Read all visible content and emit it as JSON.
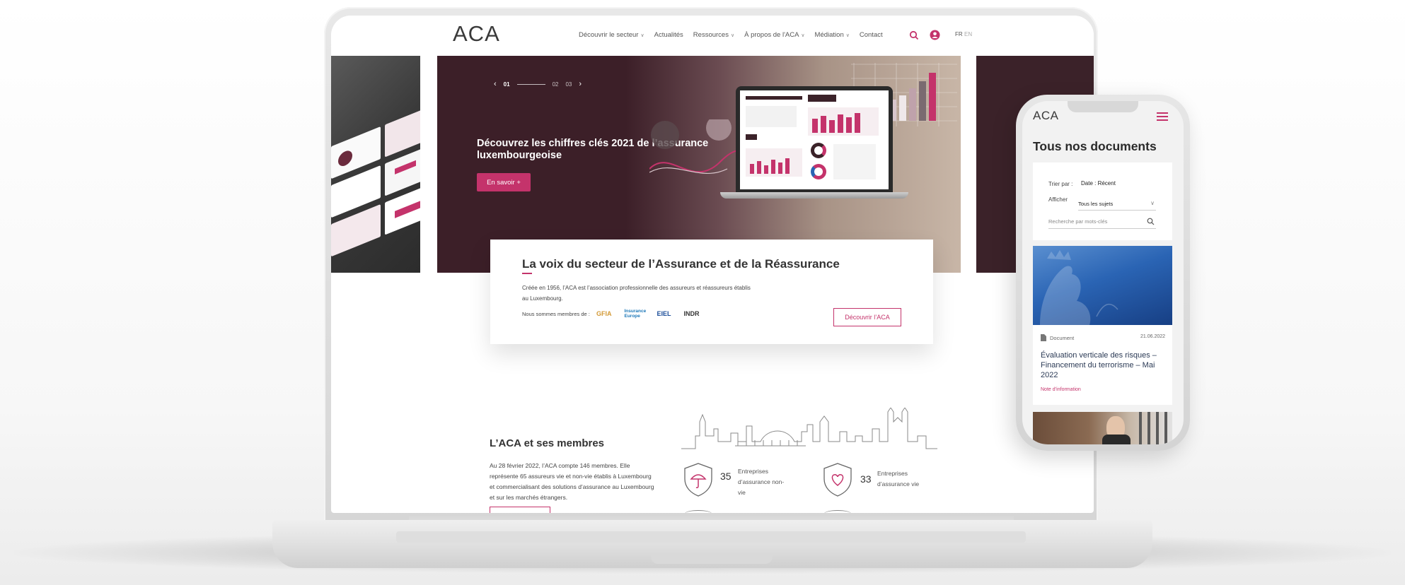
{
  "brand": {
    "logo": "ACA",
    "accent": "#c4336b",
    "dark": "#3c1f28"
  },
  "nav": {
    "items": [
      {
        "label": "Découvrir le secteur",
        "dropdown": true
      },
      {
        "label": "Actualités",
        "dropdown": false
      },
      {
        "label": "Ressources",
        "dropdown": true
      },
      {
        "label": "À propos de l'ACA",
        "dropdown": true
      },
      {
        "label": "Médiation",
        "dropdown": true
      },
      {
        "label": "Contact",
        "dropdown": false
      }
    ],
    "lang_fr": "FR",
    "lang_en": "EN",
    "icons": [
      "search-icon",
      "user-icon"
    ]
  },
  "hero": {
    "title": "Découvrez les chiffres clés 2021 de l’assurance luxembourgeoise",
    "button": "En savoir +",
    "pager": {
      "current": "01",
      "p2": "02",
      "p3": "03"
    }
  },
  "intro": {
    "title": "La voix du secteur de l’Assurance et de la Réassurance",
    "text": "Créée en 1956, l’ACA est l’association professionnelle des assureurs et réassureurs établis au Luxembourg.",
    "members_label": "Nous sommes membres de :",
    "partners": [
      "GFIA",
      "Insurance Europe",
      "EIEL",
      "INDR"
    ],
    "button": "Découvrir l’ACA"
  },
  "members": {
    "title": "L’ACA et ses membres",
    "text": "Au 28 février 2022, l’ACA compte 146 membres. Elle représente 65 assureurs vie et non-vie établis à Luxembourg et commercialisant des solutions d’assurance au Luxembourg et sur les marchés étrangers.",
    "stats": [
      {
        "value": "35",
        "label": "Entreprises d’assurance non-vie",
        "icon": "umbrella-icon"
      },
      {
        "value": "33",
        "label": "Entreprises d’assurance vie",
        "icon": "heart-icon"
      }
    ]
  },
  "mobile": {
    "logo": "ACA",
    "title": "Tous nos documents",
    "sort_label": "Trier par :",
    "sort_value": "Date : Récent",
    "show_label": "Afficher",
    "show_value": "Tous les sujets",
    "search_placeholder": "Recherche par mots-clés",
    "doc": {
      "type": "Document",
      "date": "21.06.2022",
      "title": "Évaluation verticale des risques – Financement du terrorisme – Mai 2022",
      "tag": "Note d’information"
    }
  }
}
